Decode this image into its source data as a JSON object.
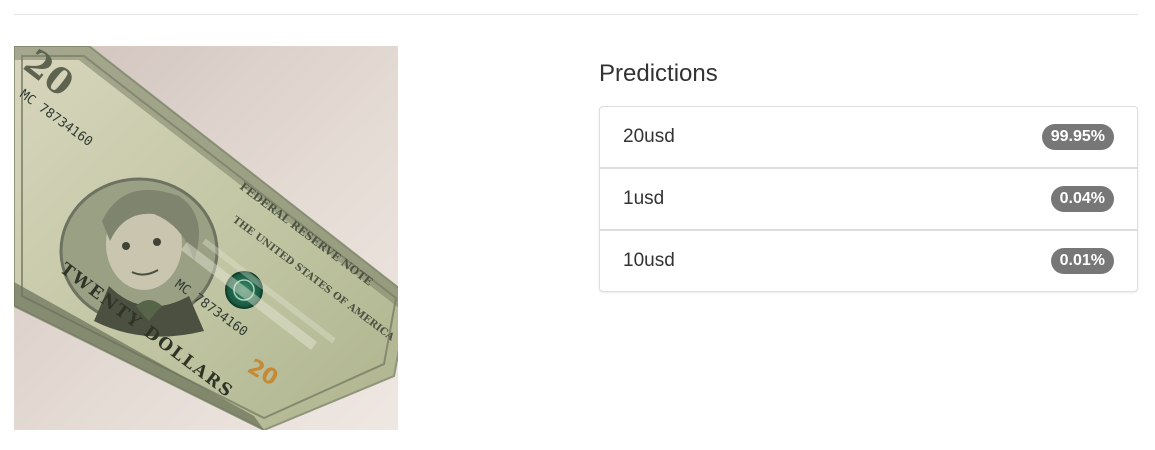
{
  "image": {
    "subject": "twenty-dollar-bill",
    "bill": {
      "denomination_mark": "20",
      "serial": "MC 78734160",
      "top_text": "FEDERAL RESERVE NOTE",
      "side_text": "THE UNITED STATES OF AMERICA",
      "bottom_text": "TWENTY DOLLARS"
    }
  },
  "predictions": {
    "title": "Predictions",
    "items": [
      {
        "label": "20usd",
        "probability": "99.95%"
      },
      {
        "label": "1usd",
        "probability": "0.04%"
      },
      {
        "label": "10usd",
        "probability": "0.01%"
      }
    ]
  },
  "colors": {
    "badge": "#777777",
    "border": "#dddddd",
    "text": "#333333",
    "bill_green": "#b9c3a2",
    "seal_green": "#1f6b4f"
  }
}
